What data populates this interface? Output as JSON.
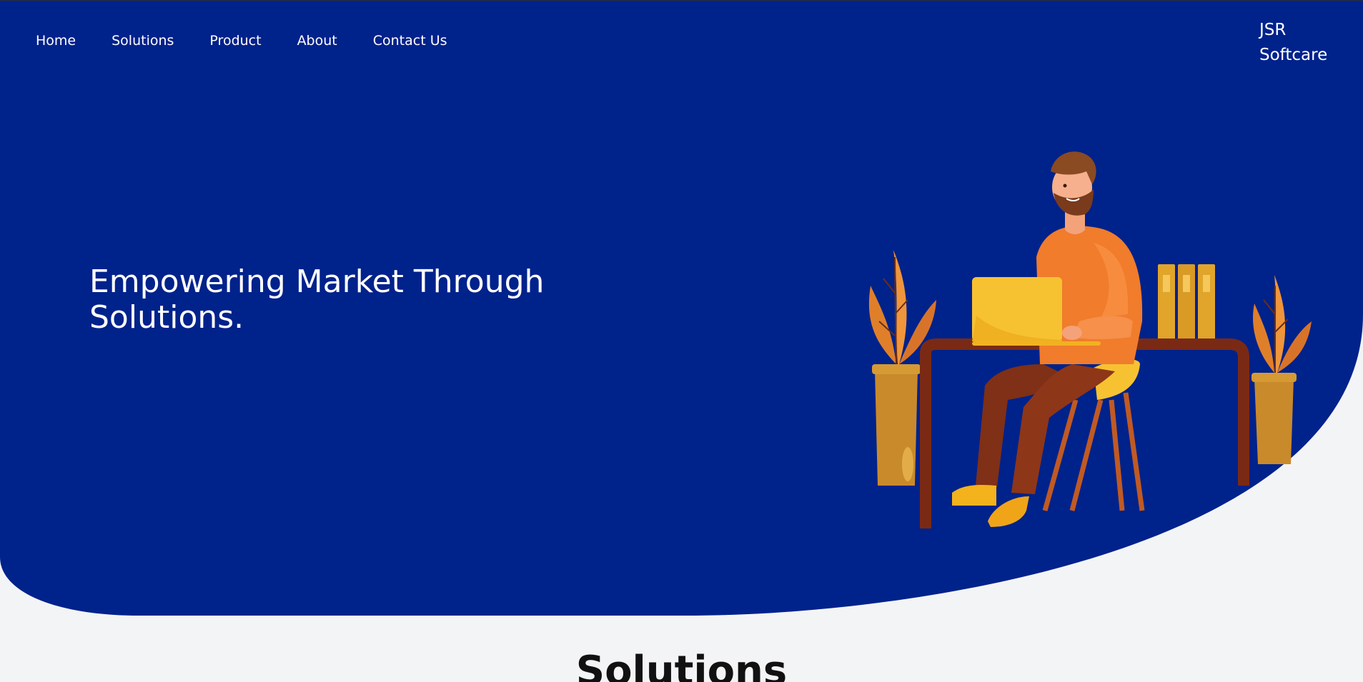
{
  "nav": {
    "items": [
      {
        "label": "Home"
      },
      {
        "label": "Solutions"
      },
      {
        "label": "Product"
      },
      {
        "label": "About"
      },
      {
        "label": "Contact Us"
      }
    ]
  },
  "brand": {
    "name": "JSR Softcare"
  },
  "hero": {
    "title": "Empowering Market Through Solutions.",
    "illustration_icon": "person-at-desk-illustration"
  },
  "sections": {
    "solutions_title": "Solutions"
  },
  "colors": {
    "hero_blue": "#00228b",
    "page_bg": "#f3f4f6",
    "text_light": "#ffffff",
    "text_dark": "#111111"
  }
}
